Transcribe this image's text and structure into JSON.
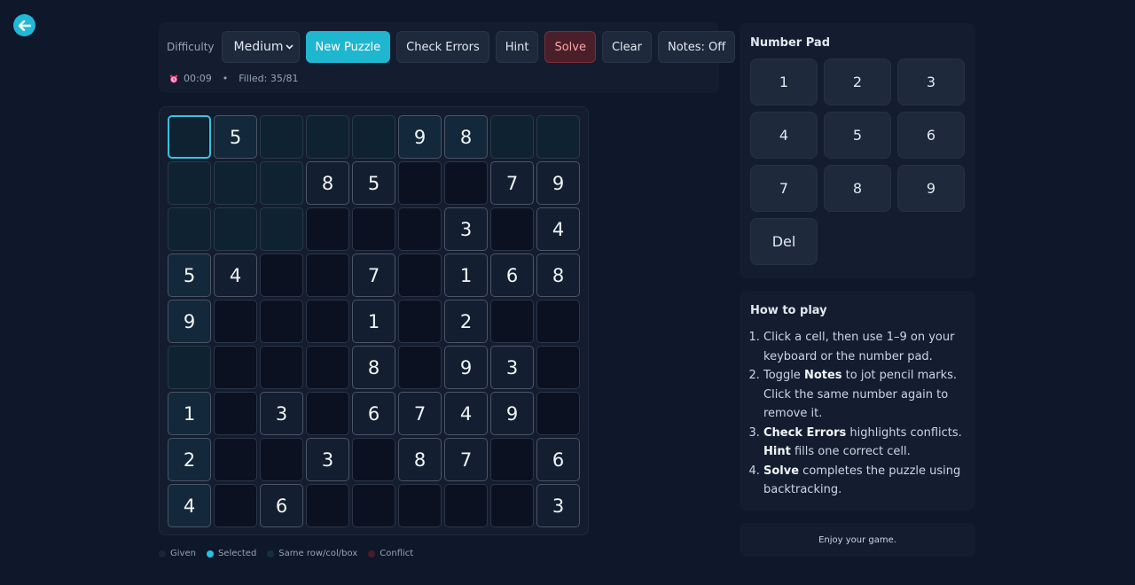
{
  "toolbar": {
    "difficulty_label": "Difficulty",
    "difficulty_value": "Medium",
    "new_puzzle": "New Puzzle",
    "check_errors": "Check Errors",
    "hint": "Hint",
    "solve": "Solve",
    "clear": "Clear",
    "notes": "Notes: Off"
  },
  "status": {
    "timer": "00:09",
    "separator": "•",
    "filled": "Filled: 35/81"
  },
  "board": {
    "selected": [
      0,
      0
    ],
    "rows": [
      [
        "",
        "5",
        "",
        "",
        "",
        "9",
        "8",
        "",
        ""
      ],
      [
        "",
        "",
        "",
        "8",
        "5",
        "",
        "",
        "7",
        "9"
      ],
      [
        "",
        "",
        "",
        "",
        "",
        "",
        "3",
        "",
        "4"
      ],
      [
        "5",
        "4",
        "",
        "",
        "7",
        "",
        "1",
        "6",
        "8"
      ],
      [
        "9",
        "",
        "",
        "",
        "1",
        "",
        "2",
        "",
        ""
      ],
      [
        "",
        "",
        "",
        "",
        "8",
        "",
        "9",
        "3",
        ""
      ],
      [
        "1",
        "",
        "3",
        "",
        "6",
        "7",
        "4",
        "9",
        ""
      ],
      [
        "2",
        "",
        "",
        "3",
        "",
        "8",
        "7",
        "",
        "6"
      ],
      [
        "4",
        "",
        "6",
        "",
        "",
        "",
        "",
        "",
        "3"
      ]
    ]
  },
  "legend": {
    "given": "Given",
    "selected": "Selected",
    "peer": "Same row/col/box",
    "conflict": "Conflict"
  },
  "numpad": {
    "title": "Number Pad",
    "keys": [
      "1",
      "2",
      "3",
      "4",
      "5",
      "6",
      "7",
      "8",
      "9",
      "Del"
    ]
  },
  "howto": {
    "title": "How to play",
    "steps": [
      {
        "pre": "Click a cell, then use 1–9 on your keyboard or the number pad.",
        "bold": "",
        "post": ""
      },
      {
        "pre": "Toggle ",
        "bold": "Notes",
        "post": " to jot pencil marks. Click the same number again to remove it."
      },
      {
        "pre": "",
        "bold": "Check Errors",
        "post": " highlights conflicts.",
        "bold2": "Hint",
        "post2": " fills one correct cell."
      },
      {
        "pre": "",
        "bold": "Solve",
        "post": " completes the puzzle using backtracking."
      }
    ]
  },
  "footer": "Enjoy your game.",
  "colors": {
    "accent": "#22b8d8",
    "background": "#0f172a",
    "panel": "#141d30",
    "danger": "#7a2d3a",
    "legend_given": "#1a2638",
    "legend_selected": "#22c3e6",
    "legend_peer": "#123040",
    "legend_conflict": "#4a1c24"
  }
}
